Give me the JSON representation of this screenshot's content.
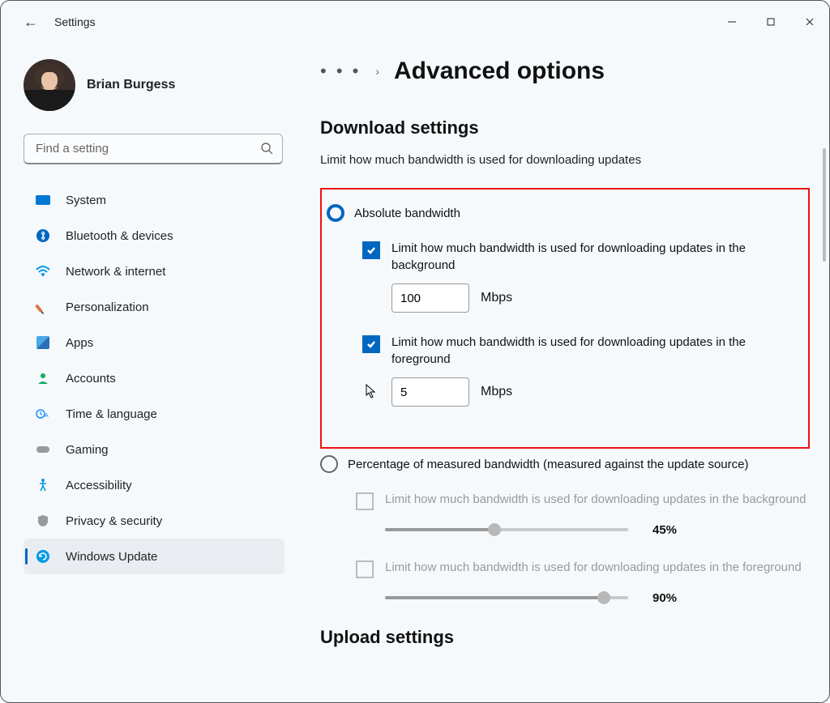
{
  "app_title": "Settings",
  "user": {
    "name": "Brian Burgess"
  },
  "search": {
    "placeholder": "Find a setting"
  },
  "nav": {
    "system": "System",
    "bluetooth": "Bluetooth & devices",
    "network": "Network & internet",
    "personalization": "Personalization",
    "apps": "Apps",
    "accounts": "Accounts",
    "time": "Time & language",
    "gaming": "Gaming",
    "accessibility": "Accessibility",
    "privacy": "Privacy & security",
    "update": "Windows Update"
  },
  "breadcrumb": {
    "dots": "• • •",
    "page_title": "Advanced options"
  },
  "download": {
    "section_title": "Download settings",
    "desc": "Limit how much bandwidth is used for downloading updates",
    "radio_absolute": "Absolute bandwidth",
    "radio_percentage": "Percentage of measured bandwidth (measured against the update source)",
    "bg_label": "Limit how much bandwidth is used for downloading updates in the background",
    "fg_label": "Limit how much bandwidth is used for downloading updates in the foreground",
    "bg_value": "100",
    "fg_value": "5",
    "unit": "Mbps",
    "pct_bg_label": "Limit how much bandwidth is used for downloading updates in the background",
    "pct_fg_label": "Limit how much bandwidth is used for downloading updates in the foreground",
    "pct_bg": "45%",
    "pct_fg": "90%"
  },
  "upload": {
    "section_title": "Upload settings"
  }
}
